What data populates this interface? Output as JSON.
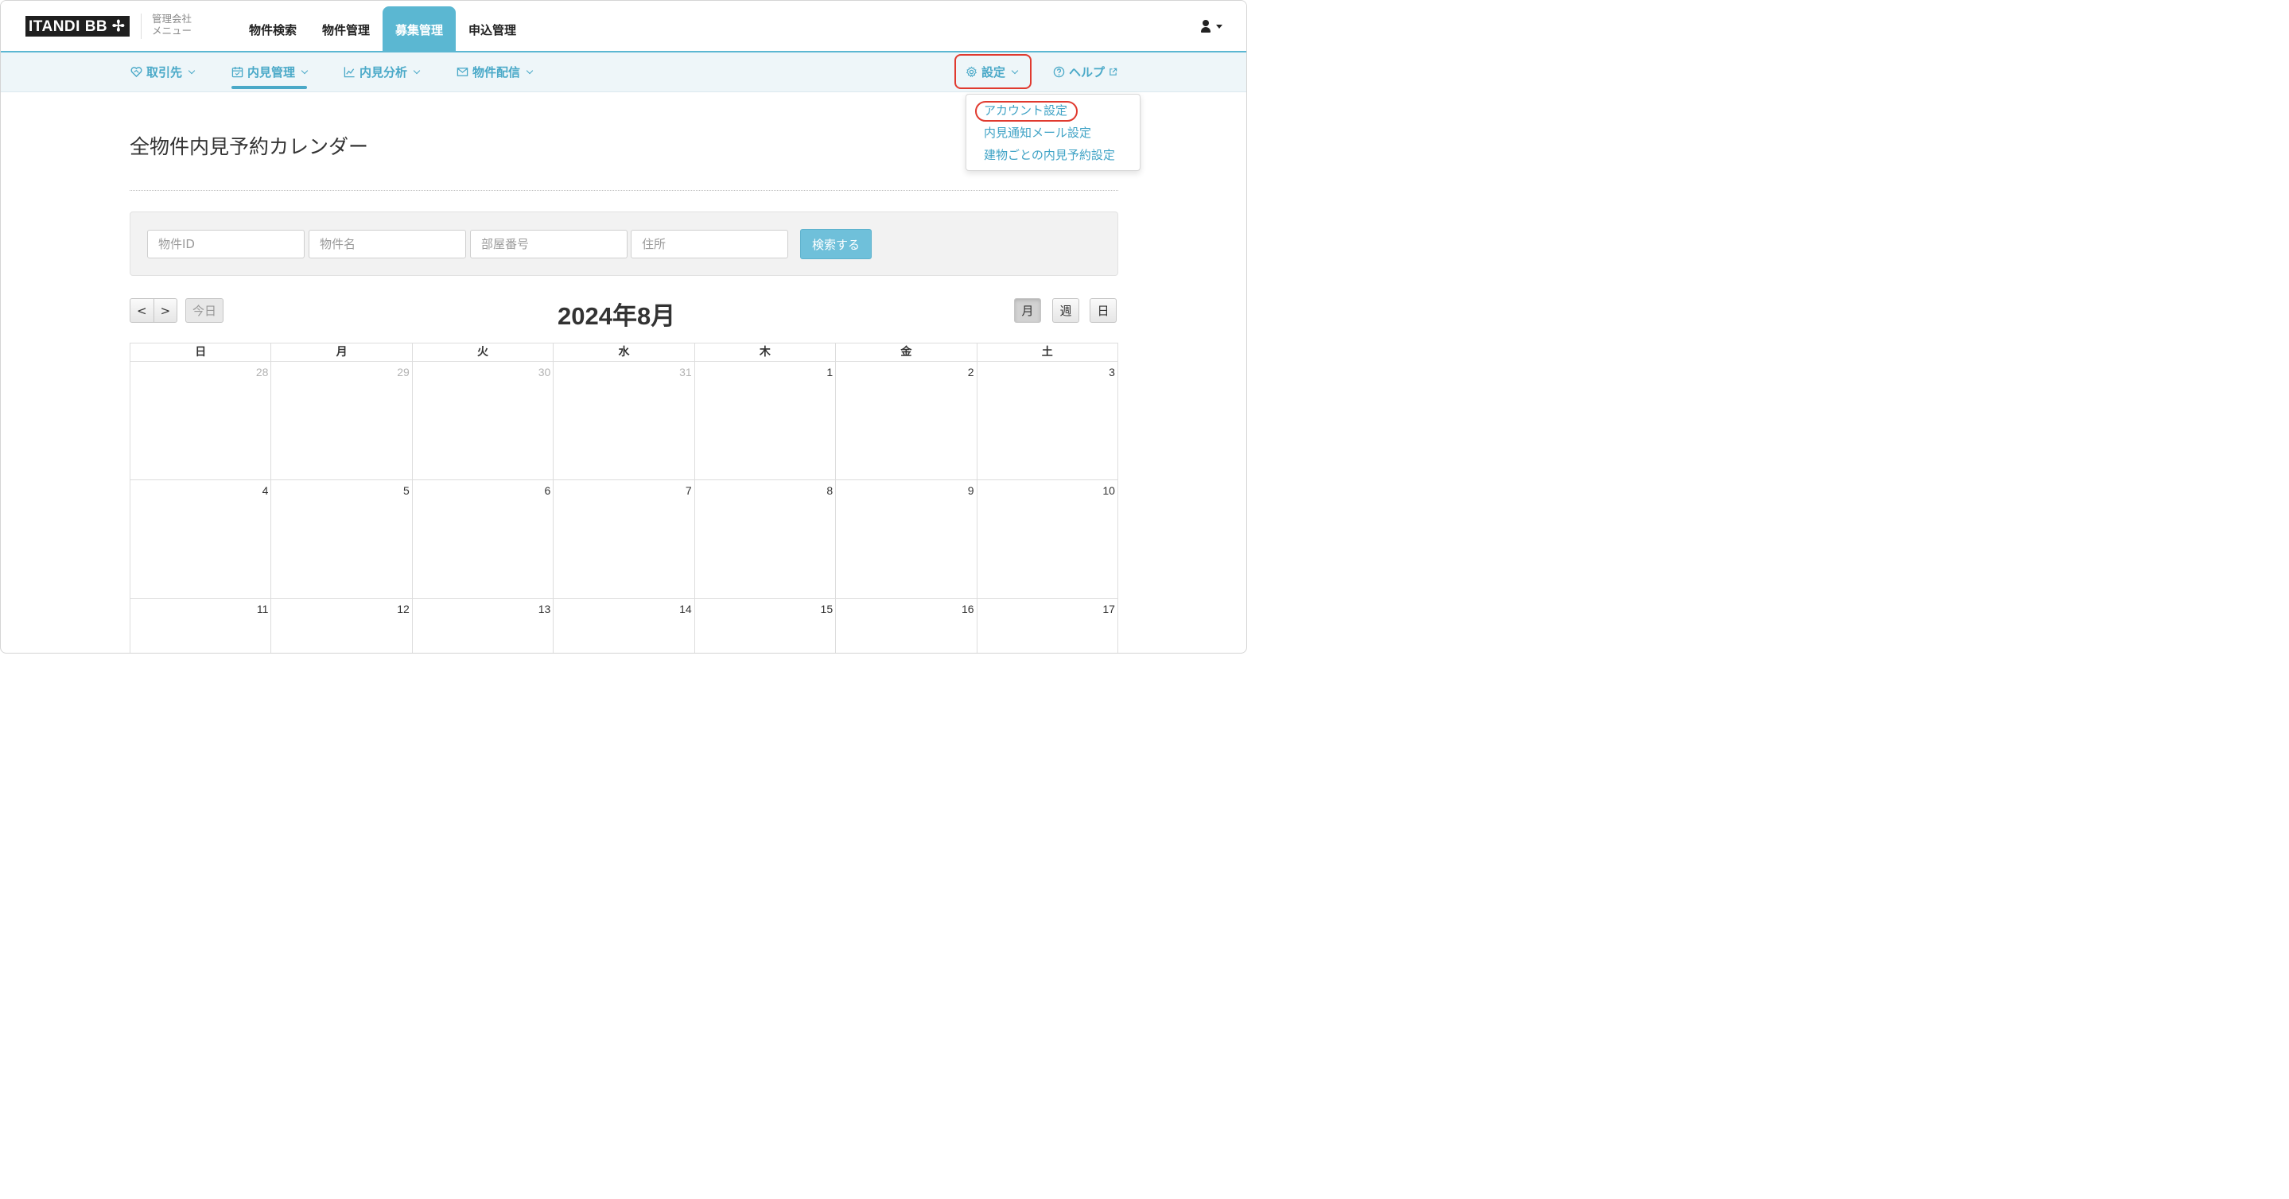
{
  "header": {
    "logo_text": "ITANDI BB ✢",
    "logo_sub_line1": "管理会社",
    "logo_sub_line2": "メニュー",
    "tabs": [
      {
        "label": "物件検索"
      },
      {
        "label": "物件管理"
      },
      {
        "label": "募集管理",
        "active": true
      },
      {
        "label": "申込管理"
      }
    ]
  },
  "subnav": {
    "items": [
      {
        "label": "取引先",
        "icon": "handshake-icon"
      },
      {
        "label": "内見管理",
        "icon": "calendar-icon",
        "active": true
      },
      {
        "label": "内見分析",
        "icon": "line-chart-icon"
      },
      {
        "label": "物件配信",
        "icon": "mail-send-icon"
      }
    ],
    "settings_label": "設定",
    "help_label": "ヘルプ"
  },
  "settings_dropdown": {
    "items": [
      {
        "label": "アカウント設定"
      },
      {
        "label": "内見通知メール設定"
      },
      {
        "label": "建物ごとの内見予約設定"
      }
    ]
  },
  "page_title": "全物件内見予約カレンダー",
  "search": {
    "property_id_placeholder": "物件ID",
    "property_name_placeholder": "物件名",
    "room_number_placeholder": "部屋番号",
    "address_placeholder": "住所",
    "submit_label": "検索する"
  },
  "calendar": {
    "prev_label": "<",
    "next_label": ">",
    "today_label": "今日",
    "title": "2024年8月",
    "views": [
      {
        "label": "月",
        "active": true
      },
      {
        "label": "週"
      },
      {
        "label": "日"
      }
    ],
    "weekdays": [
      "日",
      "月",
      "火",
      "水",
      "木",
      "金",
      "土"
    ],
    "weeks": [
      [
        {
          "d": "28",
          "o": true
        },
        {
          "d": "29",
          "o": true
        },
        {
          "d": "30",
          "o": true
        },
        {
          "d": "31",
          "o": true
        },
        {
          "d": "1"
        },
        {
          "d": "2"
        },
        {
          "d": "3"
        }
      ],
      [
        {
          "d": "4"
        },
        {
          "d": "5"
        },
        {
          "d": "6"
        },
        {
          "d": "7"
        },
        {
          "d": "8"
        },
        {
          "d": "9"
        },
        {
          "d": "10"
        }
      ],
      [
        {
          "d": "11"
        },
        {
          "d": "12"
        },
        {
          "d": "13"
        },
        {
          "d": "14"
        },
        {
          "d": "15"
        },
        {
          "d": "16"
        },
        {
          "d": "17"
        }
      ]
    ]
  },
  "colors": {
    "accent": "#5bb7d2",
    "link": "#4aa9c8",
    "highlight": "#e03a2f"
  }
}
